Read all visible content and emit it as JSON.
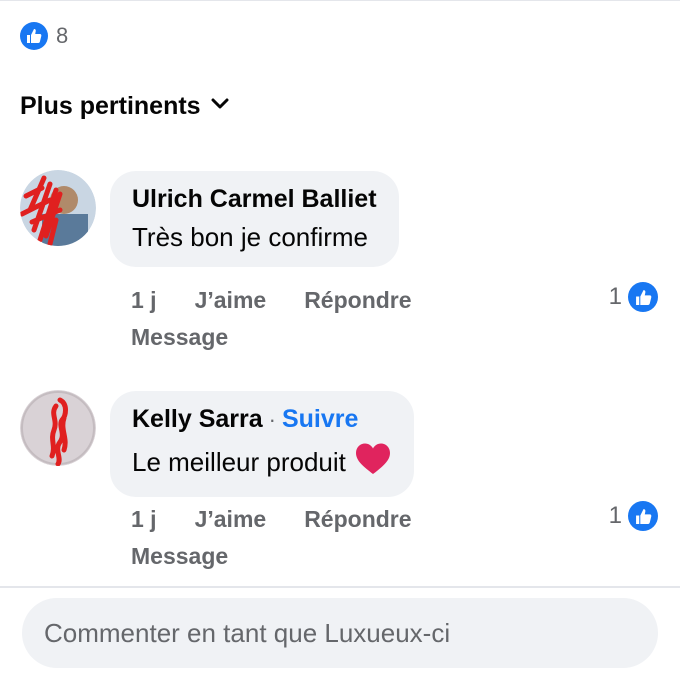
{
  "reactions": {
    "icon": "like-icon",
    "count": "8"
  },
  "sort": {
    "label": "Plus pertinents",
    "icon": "chevron-down-icon"
  },
  "comments": [
    {
      "author": "Ulrich Carmel Balliet",
      "text": "Très bon je confirme",
      "time": "1 j",
      "like_label": "J’aime",
      "reply_label": "Répondre",
      "message_label": "Message",
      "reaction_count": "1"
    },
    {
      "author": "Kelly Sarra",
      "separator": "·",
      "follow_label": "Suivre",
      "text": "Le meilleur produit",
      "emoji": "heart-emoji",
      "time": "1 j",
      "like_label": "J’aime",
      "reply_label": "Répondre",
      "message_label": "Message",
      "reaction_count": "1"
    }
  ],
  "composer": {
    "placeholder": "Commenter en tant que Luxueux-ci"
  },
  "colors": {
    "accent": "#1877f2",
    "bubble": "#f0f2f5",
    "muted": "#65676b",
    "heart": "#e0245e",
    "scribble": "#e0201f"
  }
}
